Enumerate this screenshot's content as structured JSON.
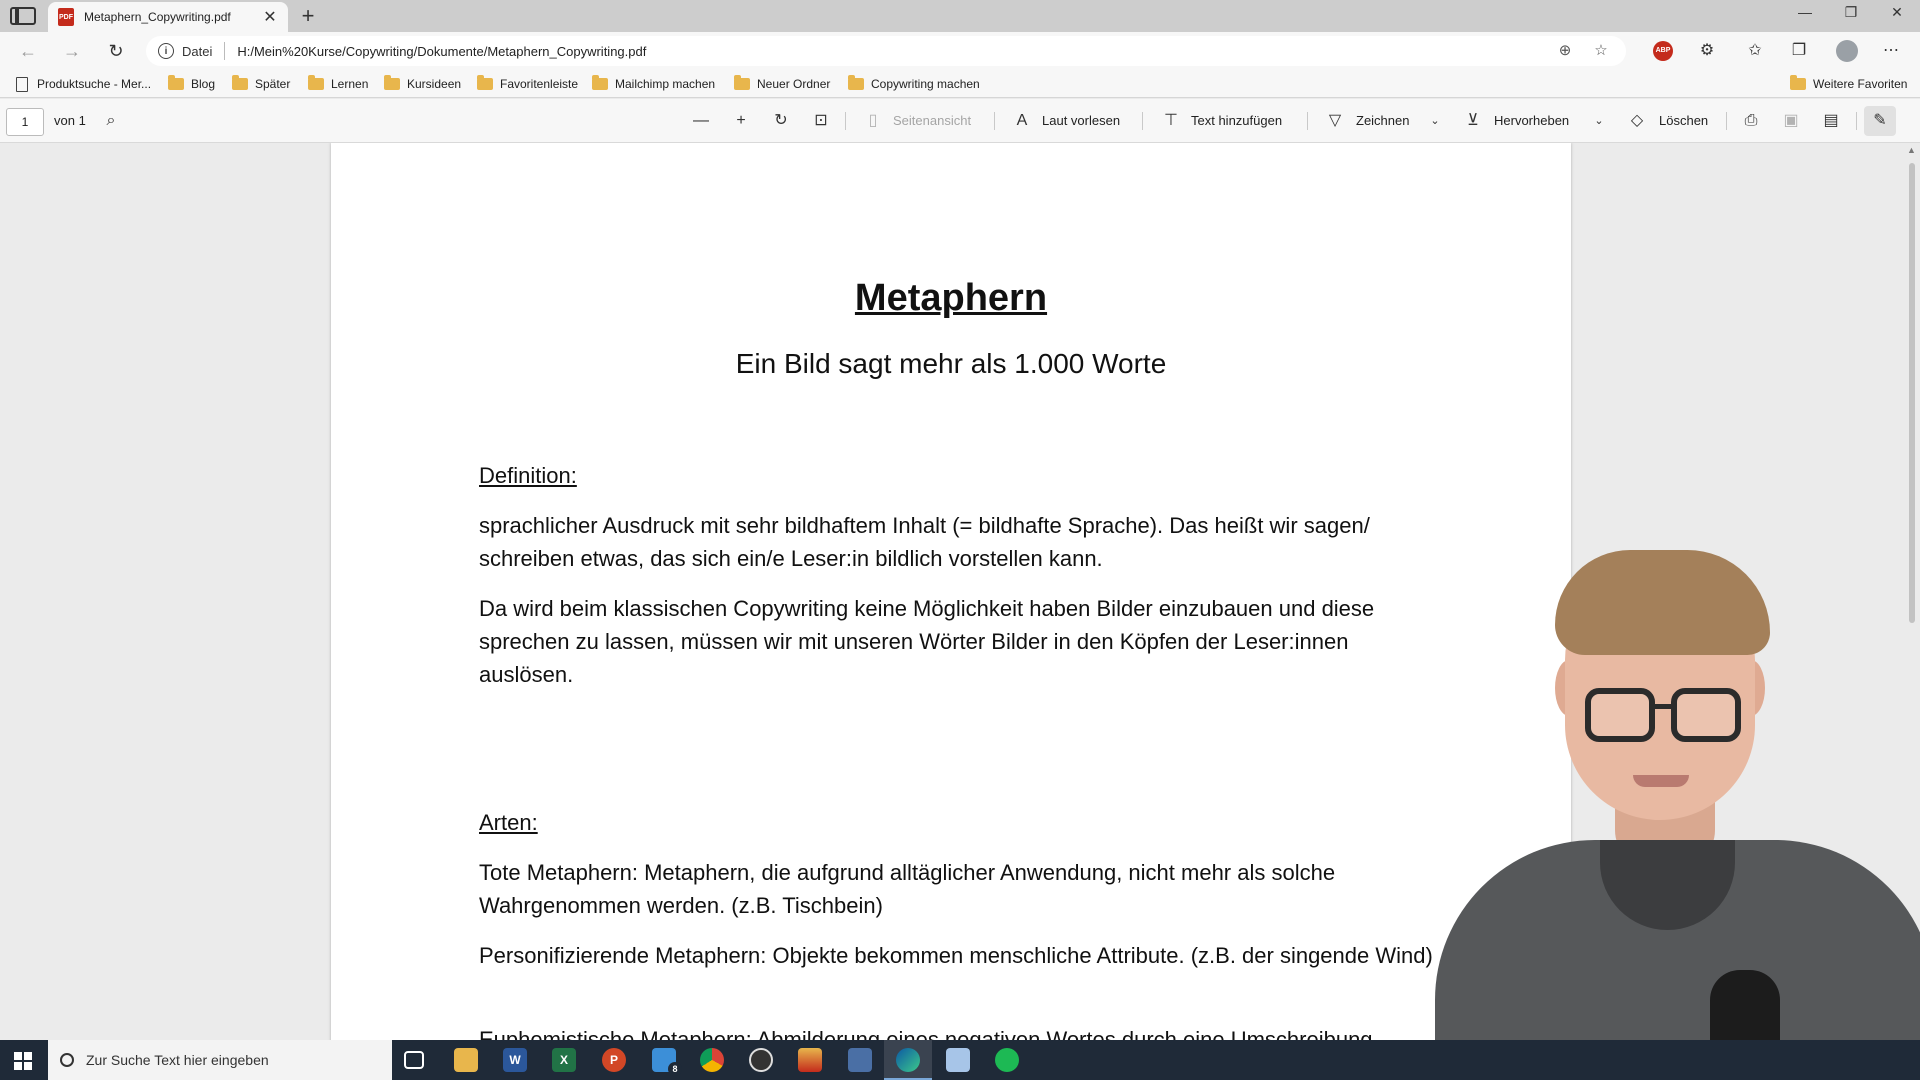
{
  "tab": {
    "title": "Metaphern_Copywriting.pdf",
    "close": "✕",
    "new_tab": "+"
  },
  "window_controls": {
    "minimize": "—",
    "restore": "❐",
    "close": "✕"
  },
  "address": {
    "scheme_label": "Datei",
    "url": "H:/Mein%20Kurse/Copywriting/Dokumente/Metaphern_Copywriting.pdf"
  },
  "adblock_label": "ABP",
  "bookmarks": {
    "items": [
      {
        "label": "Produktsuche - Mer...",
        "type": "page"
      },
      {
        "label": "Blog",
        "type": "folder"
      },
      {
        "label": "Später",
        "type": "folder"
      },
      {
        "label": "Lernen",
        "type": "folder"
      },
      {
        "label": "Kursideen",
        "type": "folder"
      },
      {
        "label": "Favoritenleiste",
        "type": "folder"
      },
      {
        "label": "Mailchimp machen",
        "type": "folder"
      },
      {
        "label": "Neuer Ordner",
        "type": "folder"
      },
      {
        "label": "Copywriting machen",
        "type": "folder"
      }
    ],
    "more": "Weitere Favoriten"
  },
  "pdf_toolbar": {
    "page_current": "1",
    "page_total": "von 1",
    "zoom_out": "—",
    "zoom_in": "+",
    "page_view": "Seitenansicht",
    "read_aloud": "Laut vorlesen",
    "add_text": "Text hinzufügen",
    "draw": "Zeichnen",
    "highlight": "Hervorheben",
    "erase": "Löschen"
  },
  "document": {
    "title": "Metaphern",
    "subtitle": "Ein Bild sagt mehr als 1.000 Worte",
    "definition_heading": "Definition:",
    "definition_p1": "sprachlicher Ausdruck mit sehr bildhaftem Inhalt (= bildhafte Sprache). Das heißt wir sagen/ schreiben etwas, das sich ein/e Leser:in bildlich vorstellen kann.",
    "definition_p2": "Da wird beim klassischen Copywriting keine Möglichkeit haben Bilder einzubauen und diese sprechen zu lassen, müssen wir mit unseren Wörter Bilder in den Köpfen der Leser:innen auslösen.",
    "types_heading": "Arten:",
    "types_p1": "Tote Metaphern: Metaphern, die aufgrund alltäglicher Anwendung, nicht mehr als solche Wahrgenommen werden. (z.B. Tischbein)",
    "types_p2": "Personifizierende Metaphern: Objekte bekommen menschliche Attribute. (z.B. der singende Wind)",
    "types_p3": "Euphemistische Metaphern: Abmilderung eines negativen Wortes durch eine Umschreibung"
  },
  "taskbar": {
    "search_placeholder": "Zur Suche Text hier eingeben",
    "mail_badge": "8",
    "apps": [
      "task-view",
      "file-explorer",
      "word",
      "excel",
      "powerpoint",
      "mail",
      "chrome",
      "obs",
      "app",
      "app",
      "edge",
      "app",
      "spotify"
    ]
  },
  "colors": {
    "accent": "#c42b1c",
    "folder": "#e8b64c",
    "taskbar": "#1f2a38"
  }
}
